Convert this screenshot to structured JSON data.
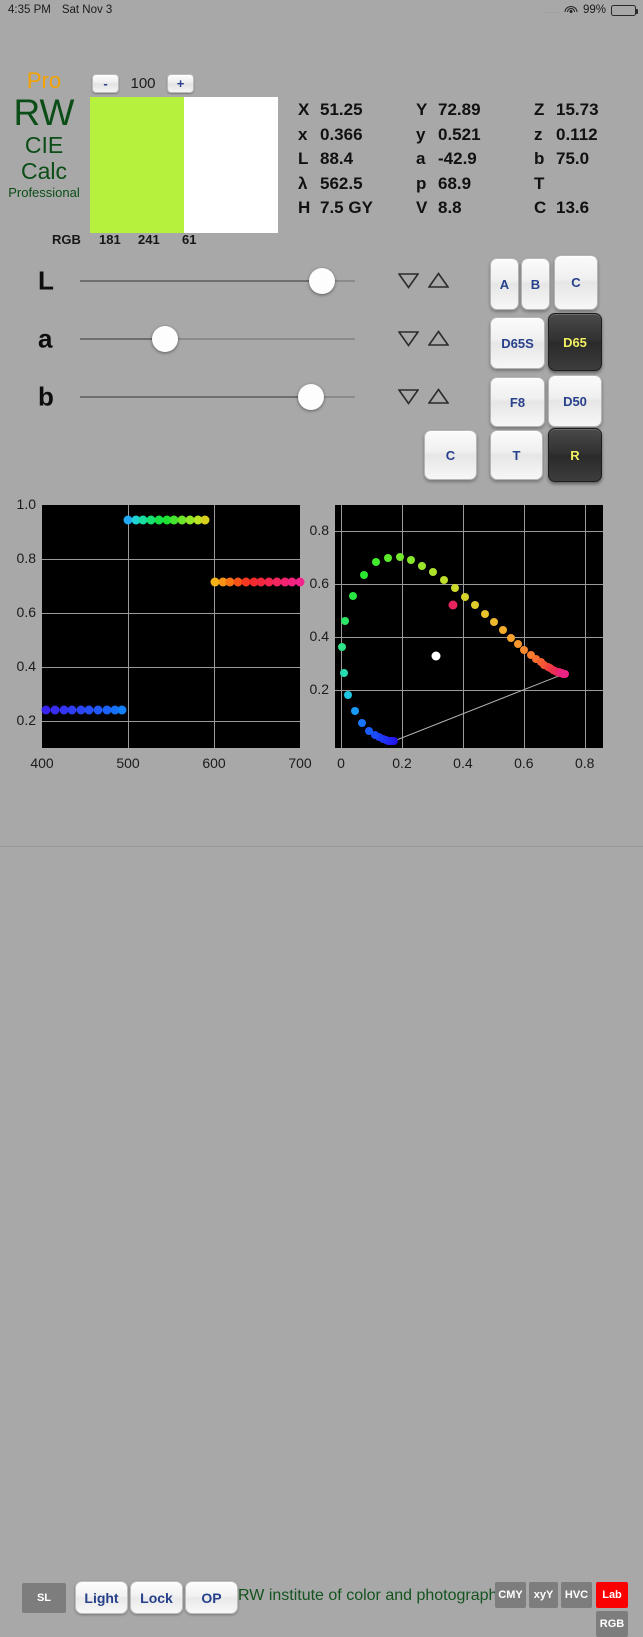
{
  "status_bar": {
    "time": "4:35 PM",
    "date": "Sat Nov 3",
    "signal_dots": "....",
    "wifi_icon": "wifi-icon",
    "battery_percent": "99%",
    "battery_icon": "battery-icon"
  },
  "brand": {
    "pro": "Pro",
    "rw": "RW",
    "cie": "CIE",
    "calc": "Calc",
    "professional": "Professional",
    "pro_color": "#f5a300",
    "text_color": "#0b4d16"
  },
  "stepper": {
    "minus_label": "-",
    "plus_label": "+",
    "value": "100"
  },
  "swatch": {
    "sample_color": "#b5f13d",
    "reference_color": "#ffffff",
    "rgb_label": "RGB",
    "r": "181",
    "g": "241",
    "b": "61"
  },
  "readout": {
    "rows": [
      [
        {
          "key": "X",
          "value": "51.25"
        },
        {
          "key": "Y",
          "value": "72.89"
        },
        {
          "key": "Z",
          "value": "15.73"
        }
      ],
      [
        {
          "key": "x",
          "value": "0.366"
        },
        {
          "key": "y",
          "value": "0.521"
        },
        {
          "key": "z",
          "value": "0.112"
        }
      ],
      [
        {
          "key": "L",
          "value": "88.4"
        },
        {
          "key": "a",
          "value": "-42.9"
        },
        {
          "key": "b",
          "value": "75.0"
        }
      ],
      [
        {
          "key": "λ",
          "value": "562.5"
        },
        {
          "key": "p",
          "value": "68.9"
        },
        {
          "key": "T",
          "value": ""
        }
      ],
      [
        {
          "key": "H",
          "value": "7.5 GY"
        },
        {
          "key": "V",
          "value": "8.8"
        },
        {
          "key": "C",
          "value": "13.6"
        }
      ]
    ]
  },
  "sliders": [
    {
      "label": "L",
      "percent": 88,
      "down_icon": "triangle-down-icon",
      "up_icon": "triangle-up-icon"
    },
    {
      "label": "a",
      "percent": 31,
      "down_icon": "triangle-down-icon",
      "up_icon": "triangle-up-icon"
    },
    {
      "label": "b",
      "percent": 84,
      "down_icon": "triangle-down-icon",
      "up_icon": "triangle-up-icon"
    }
  ],
  "illuminants": {
    "selected_illuminant": "D65",
    "selected_mode": "R",
    "buttons": [
      {
        "label": "A",
        "selected": false
      },
      {
        "label": "B",
        "selected": false
      },
      {
        "label": "C",
        "selected": false
      },
      {
        "label": "D65S",
        "selected": false
      },
      {
        "label": "D65",
        "selected": true
      },
      {
        "label": "F8",
        "selected": false
      },
      {
        "label": "D50",
        "selected": false
      }
    ],
    "modes": [
      {
        "label": "C",
        "selected": false
      },
      {
        "label": "T",
        "selected": false
      },
      {
        "label": "R",
        "selected": true
      }
    ],
    "selected_color": "#f2ef62"
  },
  "bottom_bar": {
    "left_buttons": [
      {
        "label": "SL",
        "style": "flat",
        "active": false
      },
      {
        "label": "Light",
        "style": "gloss",
        "active": false
      },
      {
        "label": "Lock",
        "style": "gloss",
        "active": false
      },
      {
        "label": "OP",
        "style": "gloss",
        "active": false
      }
    ],
    "tagline": "RW institute of color and photography",
    "right_buttons": [
      {
        "label": "CMY",
        "active": false
      },
      {
        "label": "xyY",
        "active": false
      },
      {
        "label": "HVC",
        "active": false
      },
      {
        "label": "Lab",
        "active": true
      },
      {
        "label": "RGB",
        "active": false
      }
    ],
    "active_color": "#fb0000"
  },
  "chart_data": [
    {
      "type": "scatter",
      "id": "spectral-reflectance-chart",
      "title": "",
      "xlabel": "",
      "ylabel": "",
      "xlim": [
        400,
        700
      ],
      "ylim": [
        0.1,
        1.0
      ],
      "xticks": [
        400,
        500,
        600,
        700
      ],
      "yticks": [
        0.2,
        0.4,
        0.6,
        0.8,
        1.0
      ],
      "grid": true,
      "background": "#000000",
      "series": [
        {
          "name": "blue-band",
          "x": [
            405,
            415,
            425,
            435,
            445,
            455,
            465,
            475,
            485,
            493
          ],
          "y": [
            0.24,
            0.24,
            0.24,
            0.24,
            0.24,
            0.24,
            0.24,
            0.24,
            0.24,
            0.24
          ],
          "colors": [
            "#3722f0",
            "#3a2df2",
            "#3434f4",
            "#2f3df5",
            "#2a46f6",
            "#2550f7",
            "#2059f8",
            "#1b62f9",
            "#1670fa",
            "#127ffb"
          ]
        },
        {
          "name": "green-band",
          "x": [
            500,
            509,
            518,
            527,
            536,
            545,
            554,
            563,
            572,
            581,
            590
          ],
          "y": [
            0.945,
            0.945,
            0.945,
            0.945,
            0.945,
            0.945,
            0.945,
            0.945,
            0.945,
            0.945,
            0.945
          ],
          "colors": [
            "#22a9f5",
            "#1fd2d4",
            "#19dc9e",
            "#17e070",
            "#17e148",
            "#1ee233",
            "#43e42b",
            "#6ce629",
            "#93e627",
            "#b9e424",
            "#d8cf1e"
          ]
        },
        {
          "name": "red-band",
          "x": [
            601,
            610,
            619,
            628,
            637,
            646,
            655,
            664,
            673,
            682,
            691,
            700
          ],
          "y": [
            0.715,
            0.715,
            0.715,
            0.715,
            0.715,
            0.715,
            0.715,
            0.715,
            0.715,
            0.715,
            0.715,
            0.715
          ],
          "colors": [
            "#f5b217",
            "#f79414",
            "#f87413",
            "#f75318",
            "#f43822",
            "#f32b2e",
            "#f2283e",
            "#f2264f",
            "#f22560",
            "#f22470",
            "#f2237e",
            "#f2238c"
          ]
        }
      ]
    },
    {
      "type": "scatter",
      "id": "cie-chromaticity-chart",
      "title": "",
      "xlabel": "",
      "ylabel": "",
      "xlim": [
        -0.02,
        0.86
      ],
      "ylim": [
        -0.02,
        0.9
      ],
      "xticks": [
        0,
        0.2,
        0.4,
        0.6,
        0.8
      ],
      "yticks": [
        0.2,
        0.4,
        0.6,
        0.8
      ],
      "grid": true,
      "background": "#000000",
      "series": [
        {
          "name": "spectral-locus",
          "x": [
            0.174,
            0.172,
            0.17,
            0.168,
            0.164,
            0.16,
            0.154,
            0.146,
            0.136,
            0.124,
            0.11,
            0.091,
            0.069,
            0.045,
            0.023,
            0.008,
            0.004,
            0.014,
            0.038,
            0.074,
            0.115,
            0.155,
            0.192,
            0.229,
            0.265,
            0.301,
            0.339,
            0.373,
            0.406,
            0.439,
            0.471,
            0.501,
            0.53,
            0.557,
            0.581,
            0.602,
            0.622,
            0.64,
            0.655,
            0.667,
            0.678,
            0.687,
            0.695,
            0.702,
            0.708,
            0.714,
            0.719,
            0.723,
            0.726,
            0.729,
            0.731,
            0.733,
            0.734
          ],
          "y": [
            0.005,
            0.005,
            0.005,
            0.005,
            0.006,
            0.007,
            0.008,
            0.011,
            0.014,
            0.02,
            0.029,
            0.046,
            0.073,
            0.119,
            0.181,
            0.263,
            0.362,
            0.46,
            0.555,
            0.634,
            0.683,
            0.7,
            0.702,
            0.69,
            0.67,
            0.645,
            0.615,
            0.585,
            0.553,
            0.52,
            0.487,
            0.456,
            0.426,
            0.398,
            0.373,
            0.351,
            0.332,
            0.317,
            0.305,
            0.295,
            0.287,
            0.281,
            0.276,
            0.272,
            0.269,
            0.267,
            0.265,
            0.264,
            0.263,
            0.262,
            0.261,
            0.26,
            0.26
          ],
          "colors": [
            "#2211dd",
            "#2211e0",
            "#2312e4",
            "#2314e8",
            "#2318ec",
            "#231cf0",
            "#2322f3",
            "#2229f5",
            "#2132f7",
            "#1f3df8",
            "#1c4bfa",
            "#1a5cfb",
            "#1974fc",
            "#199af7",
            "#1dc5e0",
            "#27dcb0",
            "#2ee38a",
            "#2ce564",
            "#28e743",
            "#2ae82f",
            "#40ea2c",
            "#5aea2b",
            "#72e92b",
            "#87e72b",
            "#9be52b",
            "#ade22b",
            "#bdde2b",
            "#cbd92b",
            "#d7d32b",
            "#e1cb2b",
            "#e9c22c",
            "#efb82c",
            "#f3ad2c",
            "#f6a22c",
            "#f7962c",
            "#f88a2d",
            "#f87d2e",
            "#f7702f",
            "#f66331",
            "#f55635",
            "#f34a3a",
            "#f13f40",
            "#ef3648",
            "#ed2f50",
            "#ec2a58",
            "#eb2761",
            "#ea2569",
            "#ea2470",
            "#ea2476",
            "#ea237b",
            "#ea237f",
            "#ea2382",
            "#ea2384"
          ]
        }
      ],
      "annotations": [
        {
          "name": "white-point",
          "x": 0.3127,
          "y": 0.329,
          "color": "#ffffff"
        },
        {
          "name": "sample-point",
          "x": 0.366,
          "y": 0.521,
          "color": "#e8245e"
        },
        {
          "name": "purple-line",
          "from": [
            0.734,
            0.26
          ],
          "to": [
            0.174,
            0.005
          ],
          "color": "#b0b0b0"
        }
      ]
    }
  ]
}
